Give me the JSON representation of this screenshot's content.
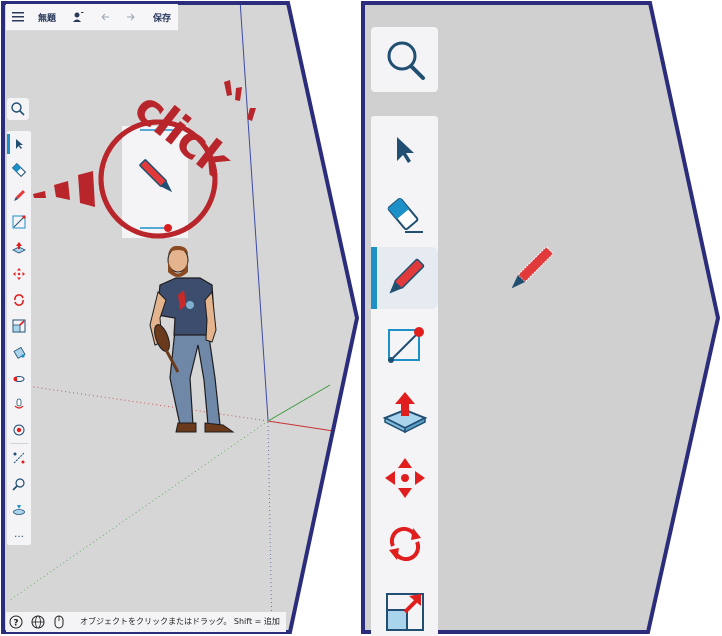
{
  "app": {
    "menu_icon": "hamburger-menu-icon",
    "title": "無題",
    "save_label": "保存",
    "user_icon": "user-add-icon",
    "undo_icon": "undo-icon",
    "redo_icon": "redo-icon"
  },
  "callout": {
    "word": "click",
    "tool": "pencil-icon"
  },
  "toolbar": {
    "search_icon": "search-icon",
    "tools": [
      {
        "name": "select",
        "icon": "select-arrow-icon"
      },
      {
        "name": "eraser",
        "icon": "eraser-icon"
      },
      {
        "name": "pencil",
        "icon": "pencil-icon",
        "active": true
      },
      {
        "name": "line",
        "icon": "line-icon"
      },
      {
        "name": "push-pull",
        "icon": "push-pull-icon"
      },
      {
        "name": "move",
        "icon": "move-icon"
      },
      {
        "name": "rotate",
        "icon": "rotate-icon"
      },
      {
        "name": "scale",
        "icon": "scale-icon"
      },
      {
        "name": "paint",
        "icon": "paint-bucket-icon"
      },
      {
        "name": "follow-me",
        "icon": "follow-me-icon"
      },
      {
        "name": "orbit",
        "icon": "orbit-icon"
      },
      {
        "name": "position-camera",
        "icon": "position-camera-icon"
      },
      {
        "name": "tape-measure",
        "icon": "tape-measure-icon"
      },
      {
        "name": "zoom",
        "icon": "zoom-icon"
      },
      {
        "name": "section",
        "icon": "section-plane-icon"
      }
    ],
    "more_label": "…"
  },
  "status": {
    "help_icon": "help-icon",
    "globe_icon": "globe-icon",
    "mouse_icon": "mouse-icon",
    "text": "オブジェクトをクリックまたはドラッグ。 Shift = 追加"
  },
  "colors": {
    "frame": "#2b2d7c",
    "canvas": "#cfcfcf",
    "accent": "#1d90c8",
    "callout_red": "#b8262b",
    "tool_blue": "#204f72"
  }
}
